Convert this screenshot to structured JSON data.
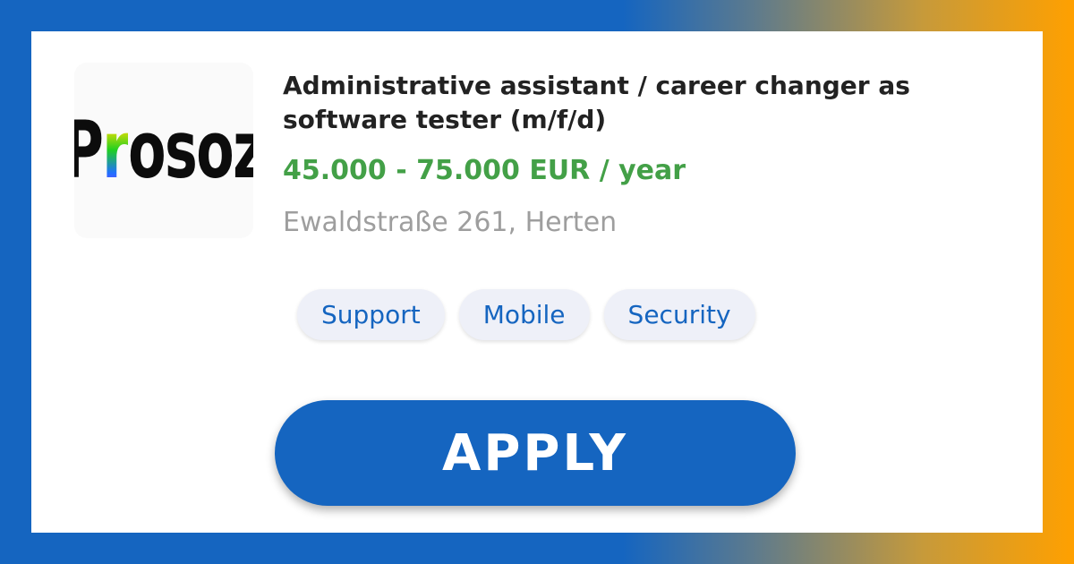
{
  "job": {
    "title": "Administrative assistant / career changer as software tester (m/f/d)",
    "salary": "45.000 - 75.000 EUR / year",
    "address": "Ewaldstraße 261, Herten"
  },
  "company": {
    "logo_text": "Prosoz",
    "logo_parts": [
      "P",
      "r",
      "osoz"
    ]
  },
  "tags": [
    "Support",
    "Mobile",
    "Security"
  ],
  "apply_label": "APPLY",
  "colors": {
    "brand_blue": "#1565c0",
    "orange": "#ffa000",
    "salary_green": "#43a047",
    "address_gray": "#9e9e9e",
    "tag_bg": "#eef0f8"
  }
}
